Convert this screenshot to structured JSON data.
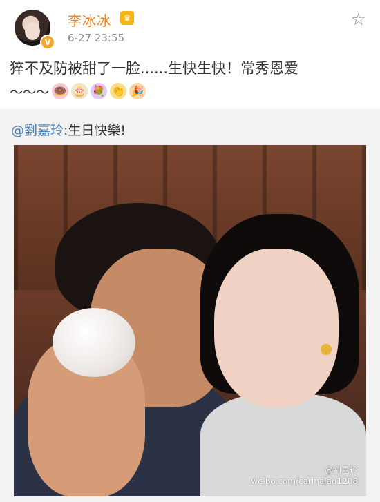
{
  "post": {
    "author": "李冰冰",
    "timestamp": "6-27 23:55",
    "text": "猝不及防被甜了一脸......生快生快！常秀恩爱",
    "tilde": "～～～",
    "emojis": [
      "🍩",
      "🎂",
      "💐",
      "👏",
      "🎉"
    ]
  },
  "repost": {
    "mention": "@劉嘉玲",
    "text": ":生日快樂!"
  },
  "watermark": {
    "handle": "@劉嘉玲",
    "url": "weibo.com/carinalau1208"
  },
  "icons": {
    "verify": "verified-badge-icon",
    "vip": "vip-crown-icon",
    "favorite": "star-icon"
  }
}
